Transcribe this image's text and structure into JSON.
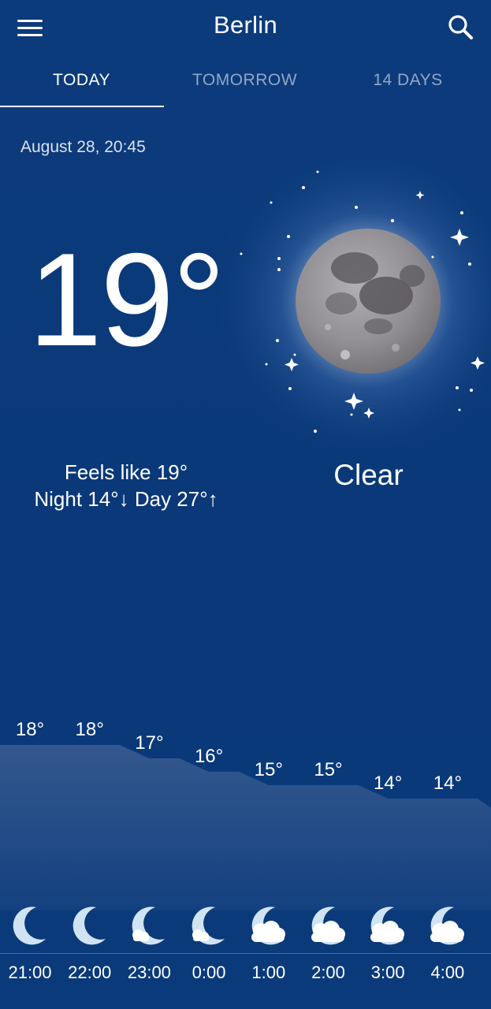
{
  "header": {
    "city": "Berlin",
    "menu_icon": "menu-icon",
    "search_icon": "search-icon"
  },
  "tabs": [
    {
      "label": "TODAY",
      "active": true
    },
    {
      "label": "TOMORROW",
      "active": false
    },
    {
      "label": "14 DAYS",
      "active": false
    }
  ],
  "current": {
    "datetime": "August 28, 20:45",
    "temperature": "19°",
    "condition": "Clear",
    "condition_icon": "full-moon-icon",
    "feels_like": "Feels like 19°",
    "night_day": "Night 14°↓ Day 27°↑"
  },
  "colors": {
    "background": "#0b3a7b",
    "chart_fill": "#3d5f93",
    "moon_icon": "#cfe3f3",
    "cloud": "#ffffff"
  },
  "hourly": [
    {
      "time": "21:00",
      "temp": "18°",
      "value": 18,
      "icon": "crescent-moon-icon"
    },
    {
      "time": "22:00",
      "temp": "18°",
      "value": 18,
      "icon": "crescent-moon-icon"
    },
    {
      "time": "23:00",
      "temp": "17°",
      "value": 17,
      "icon": "crescent-moon-small-cloud-icon"
    },
    {
      "time": "0:00",
      "temp": "16°",
      "value": 16,
      "icon": "crescent-moon-small-cloud-icon"
    },
    {
      "time": "1:00",
      "temp": "15°",
      "value": 15,
      "icon": "crescent-moon-cloud-icon"
    },
    {
      "time": "2:00",
      "temp": "15°",
      "value": 15,
      "icon": "crescent-moon-cloud-icon"
    },
    {
      "time": "3:00",
      "temp": "14°",
      "value": 14,
      "icon": "crescent-moon-cloud-icon"
    },
    {
      "time": "4:00",
      "temp": "14°",
      "value": 14,
      "icon": "crescent-moon-cloud-icon"
    }
  ]
}
